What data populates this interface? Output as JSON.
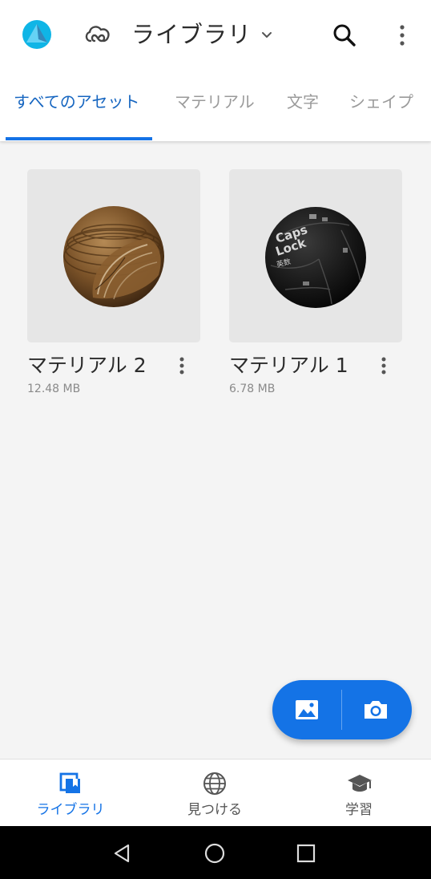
{
  "header": {
    "title": "ライブラリ",
    "app_icon": "app-logo-icon",
    "cc_icon": "creative-cloud-icon",
    "dropdown_icon": "chevron-down-icon",
    "search_icon": "search-icon",
    "menu_icon": "more-vertical-icon"
  },
  "tabs": [
    {
      "label": "すべてのアセット",
      "active": true
    },
    {
      "label": "マテリアル",
      "active": false
    },
    {
      "label": "文字",
      "active": false
    },
    {
      "label": "シェイプ",
      "active": false
    }
  ],
  "assets": [
    {
      "name": "マテリアル 2",
      "size": "12.48 MB",
      "thumbnail": "wood-sphere"
    },
    {
      "name": "マテリアル 1",
      "size": "6.78 MB",
      "thumbnail": "keyboard-keys-sphere"
    }
  ],
  "thumbnail_text": {
    "caps": "Caps",
    "lock": "Lock",
    "kanji": "英数"
  },
  "fab": {
    "image_icon": "image-icon",
    "camera_icon": "camera-icon"
  },
  "bottom_nav": [
    {
      "label": "ライブラリ",
      "icon": "library-icon",
      "active": true
    },
    {
      "label": "見つける",
      "icon": "globe-icon",
      "active": false
    },
    {
      "label": "学習",
      "icon": "graduation-cap-icon",
      "active": false
    }
  ],
  "system_nav": {
    "back": "back-icon",
    "home": "home-icon",
    "recents": "recents-icon"
  },
  "colors": {
    "accent": "#1473e6",
    "tab_active": "#1565c0",
    "background": "#f4f4f4"
  }
}
